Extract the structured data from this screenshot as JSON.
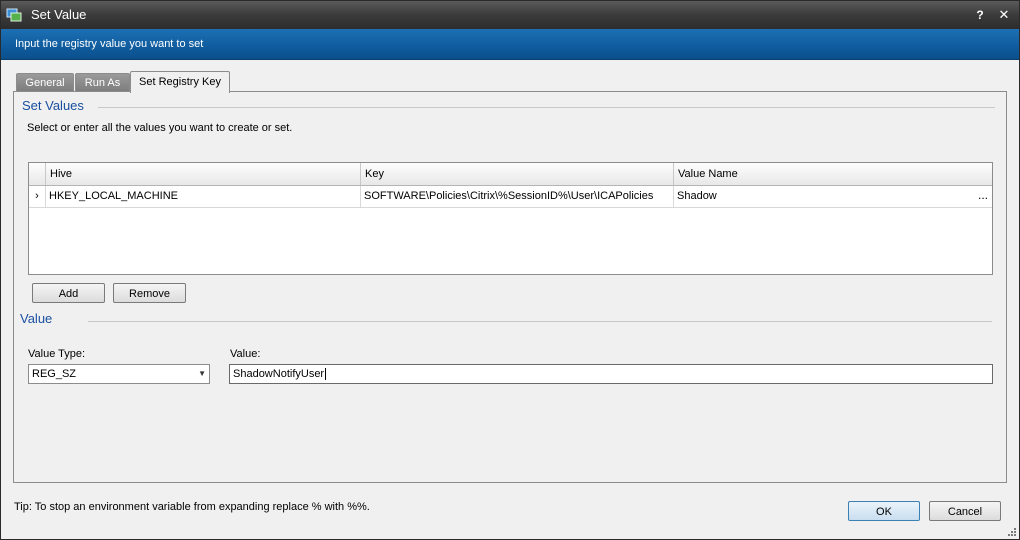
{
  "window": {
    "title": "Set Value",
    "help_glyph": "?",
    "close_glyph": "✕"
  },
  "banner": {
    "text": "Input the registry value you want to set"
  },
  "tabs": [
    {
      "label": "General"
    },
    {
      "label": "Run As"
    },
    {
      "label": "Set Registry Key"
    }
  ],
  "set_values": {
    "title": "Set Values",
    "description": "Select or enter all the values you want to create or set.",
    "grid": {
      "columns": [
        "Hive",
        "Key",
        "Value Name"
      ],
      "rows": [
        {
          "indicator": "›",
          "hive": "HKEY_LOCAL_MACHINE",
          "key": "SOFTWARE\\Policies\\Citrix\\%SessionID%\\User\\ICAPolicies",
          "value_name": "Shadow",
          "ellipsis": "..."
        }
      ]
    },
    "add_label": "Add",
    "remove_label": "Remove"
  },
  "value": {
    "title": "Value",
    "type_label": "Value Type:",
    "type_selected": "REG_SZ",
    "value_label": "Value:",
    "value_text": "ShadowNotifyUser"
  },
  "footer": {
    "tip": "Tip: To stop an environment variable from expanding replace % with %%.",
    "ok_label": "OK",
    "cancel_label": "Cancel"
  },
  "colors": {
    "banner": "#0f5c9e",
    "section_title": "#1a4fa0",
    "titlebar": "#3b3b3b"
  },
  "icons": [
    "app-icon",
    "help-icon",
    "close-icon",
    "row-indicator-icon",
    "dropdown-arrow-icon",
    "resize-grip-icon"
  ]
}
